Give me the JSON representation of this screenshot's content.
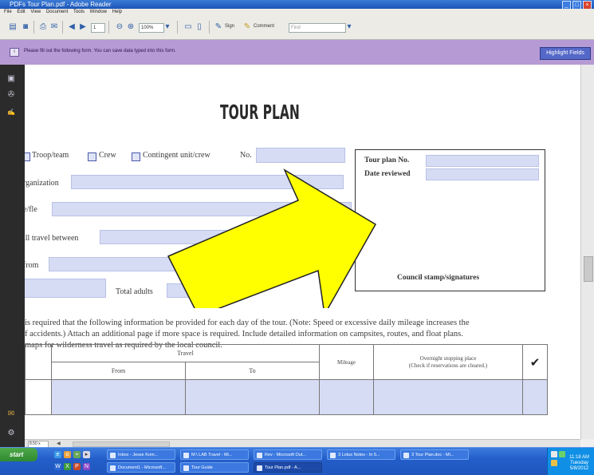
{
  "window": {
    "title": "PDFs Tour Plan.pdf - Adobe Reader"
  },
  "menu": {
    "items": [
      "File",
      "Edit",
      "View",
      "Document",
      "Tools",
      "Window",
      "Help"
    ]
  },
  "toolbar": {
    "zoom": "100%",
    "sign_label": "Sign",
    "comment_label": "Comment",
    "find_placeholder": "Find"
  },
  "infobar": {
    "message": "Please fill out the following form. You can save data typed into this form.",
    "highlight_button": "Highlight Fields"
  },
  "document": {
    "title": "TOUR PLAN",
    "checkbox_row": {
      "troop_label": "Troop/team",
      "crew_label": "Crew",
      "contingent_label": "Contingent unit/crew",
      "no_label": "No."
    },
    "labels": {
      "organization": "rganization",
      "file_no": "e/fle",
      "travel_between": "ill travel between",
      "from": "from",
      "total_adults": "Total adults"
    },
    "stamp_box": {
      "tour_plan_no": "Tour plan No.",
      "date_reviewed": "Date reviewed",
      "council_stamp": "Council stamp/signatures"
    },
    "paragraph": [
      "is required that the following information be provided for each day of the tour. (Note: Speed or excessive daily mileage increases the",
      "f accidents.) Attach an additional page if more space is required. Include detailed information on campsites, routes, and float plans.",
      "maps for wilderness travel as required by the local council."
    ],
    "table": {
      "travel_header": "Travel",
      "from_header": "From",
      "to_header": "To",
      "mileage_header": "Mileage",
      "overnight_header_line1": "Overnight stopping place",
      "overnight_header_line2": "(Check if reservations are cleared.)",
      "check_header": "✔"
    }
  },
  "status": {
    "page_size": "8.50 x 11.00 in",
    "scroll_arrow": "◀"
  },
  "taskbar": {
    "start_label": "start",
    "buttons_row1": [
      "Inbox - Jesse Kom...",
      "M:\\ LAB Travel - Mi...",
      "Rev - Microsoft Out...",
      "3 Lotus Notes - In 5...",
      "3 Tour Plan.doc - Mi..."
    ],
    "buttons_row2": [
      "Document1 - Microsoft...",
      "Tour Guide",
      "Tour Plan.pdf - A..."
    ],
    "clock_line1": "11:18 AM",
    "clock_line2": "Tuesday",
    "clock_line3": "5/8/2012"
  },
  "colors": {
    "title_bar": "#1c55b8",
    "infobar": "#b59ad4",
    "form_field": "#d6dcf4",
    "arrow_fill": "#ffff00",
    "taskbar": "#245ec9"
  }
}
